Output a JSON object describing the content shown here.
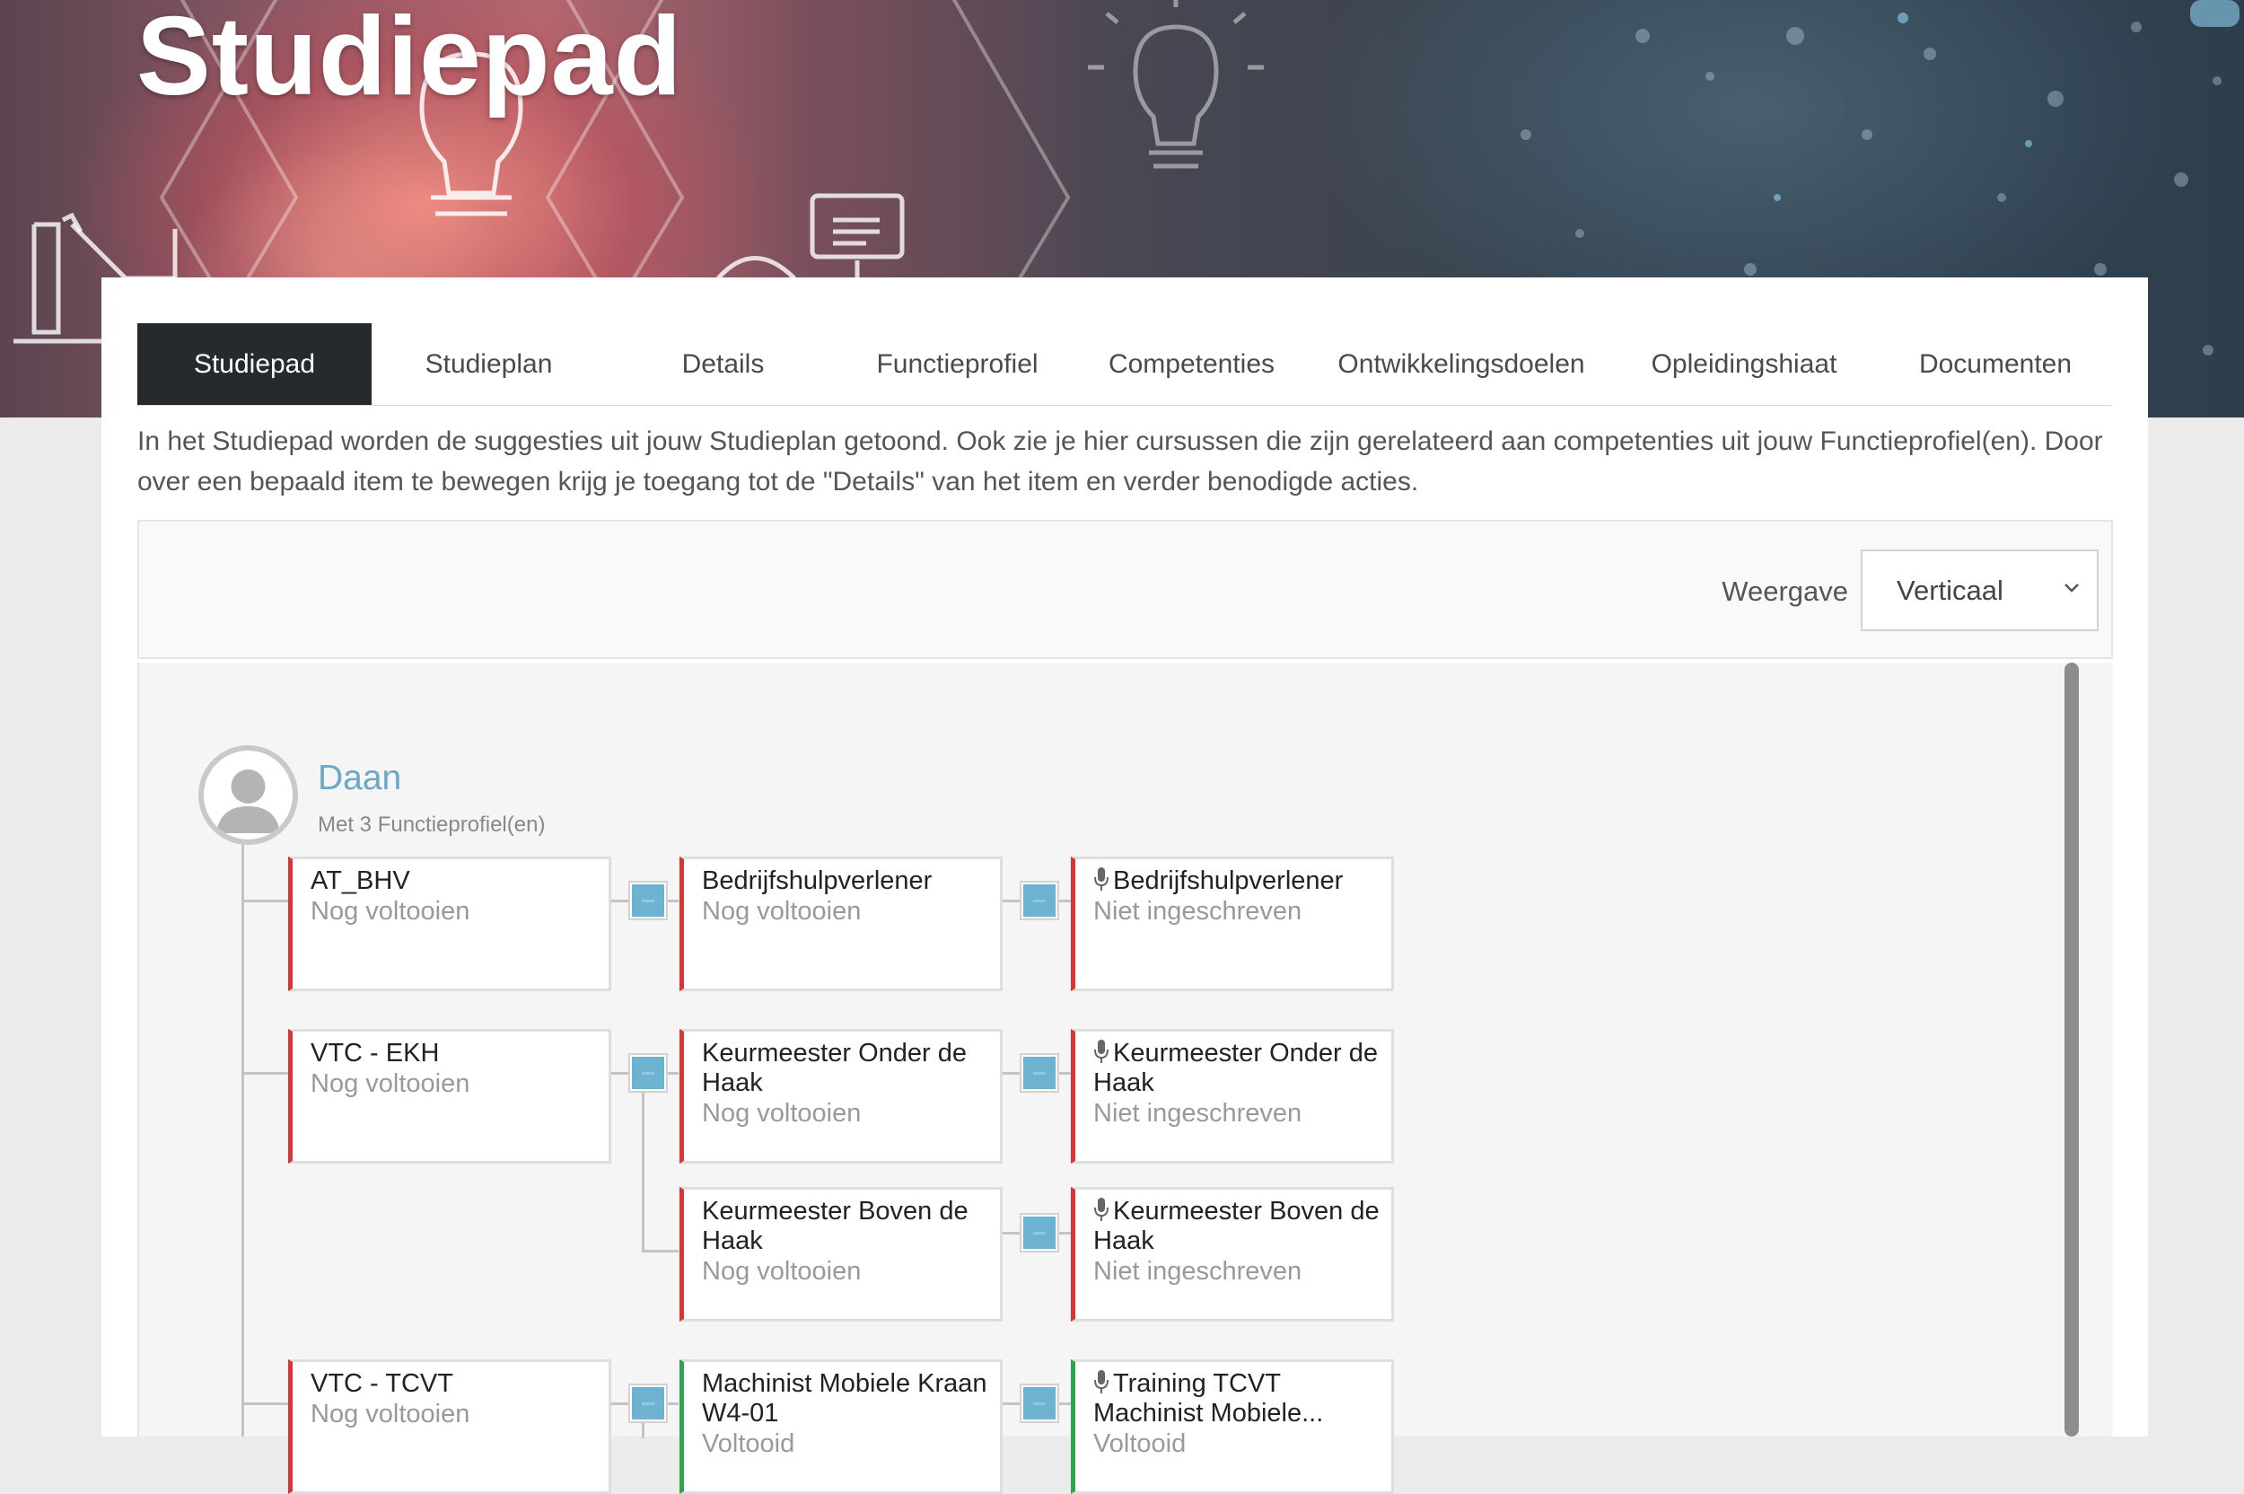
{
  "hero": {
    "title": "Studiepad"
  },
  "tabs": [
    {
      "label": "Studiepad",
      "active": true
    },
    {
      "label": "Studieplan",
      "active": false
    },
    {
      "label": "Details",
      "active": false
    },
    {
      "label": "Functieprofiel",
      "active": false
    },
    {
      "label": "Competenties",
      "active": false
    },
    {
      "label": "Ontwikkelingsdoelen",
      "active": false
    },
    {
      "label": "Opleidingshiaat",
      "active": false
    },
    {
      "label": "Documenten",
      "active": false
    }
  ],
  "intro": "In het Studiepad worden de suggesties uit jouw Studieplan getoond. Ook zie je hier cursussen die zijn gerelateerd aan competenties uit jouw Functieprofiel(en). Door over een bepaald item te bewegen krijg je toegang tot de \"Details\" van het item en verder benodigde acties.",
  "view": {
    "label": "Weergave",
    "selected": "Verticaal"
  },
  "profile": {
    "name": "Daan",
    "subtitle": "Met 3 Functieprofiel(en)"
  },
  "tree": {
    "rows": [
      {
        "profile": {
          "title": "AT_BHV",
          "status": "Nog voltooien"
        },
        "items": [
          {
            "competence": {
              "title": "Bedrijfshulpverlener",
              "status": "Nog voltooien",
              "state": "open"
            },
            "course": {
              "title": "Bedrijfshulpverlener",
              "status": "Niet ingeschreven",
              "state": "open",
              "icon": "microphone-icon"
            }
          }
        ]
      },
      {
        "profile": {
          "title": "VTC - EKH",
          "status": "Nog voltooien"
        },
        "items": [
          {
            "competence": {
              "title": "Keurmeester Onder de Haak",
              "status": "Nog voltooien",
              "state": "open"
            },
            "course": {
              "title": "Keurmeester Onder de Haak",
              "status": "Niet ingeschreven",
              "state": "open",
              "icon": "microphone-icon"
            }
          },
          {
            "competence": {
              "title": "Keurmeester Boven de Haak",
              "status": "Nog voltooien",
              "state": "open"
            },
            "course": {
              "title": "Keurmeester Boven de Haak",
              "status": "Niet ingeschreven",
              "state": "open",
              "icon": "microphone-icon"
            }
          }
        ]
      },
      {
        "profile": {
          "title": "VTC - TCVT",
          "status": "Nog voltooien"
        },
        "items": [
          {
            "competence": {
              "title": "Machinist Mobiele Kraan W4-01",
              "status": "Voltooid",
              "state": "done"
            },
            "course": {
              "title": "Training TCVT Machinist Mobiele...",
              "status": "Voltooid",
              "state": "done",
              "icon": "microphone-icon"
            }
          }
        ]
      }
    ]
  },
  "colors": {
    "accent_blue": "#6aa7c8",
    "status_open": "#dd3333",
    "status_done": "#2ea44f",
    "tab_active": "#262a2e"
  }
}
